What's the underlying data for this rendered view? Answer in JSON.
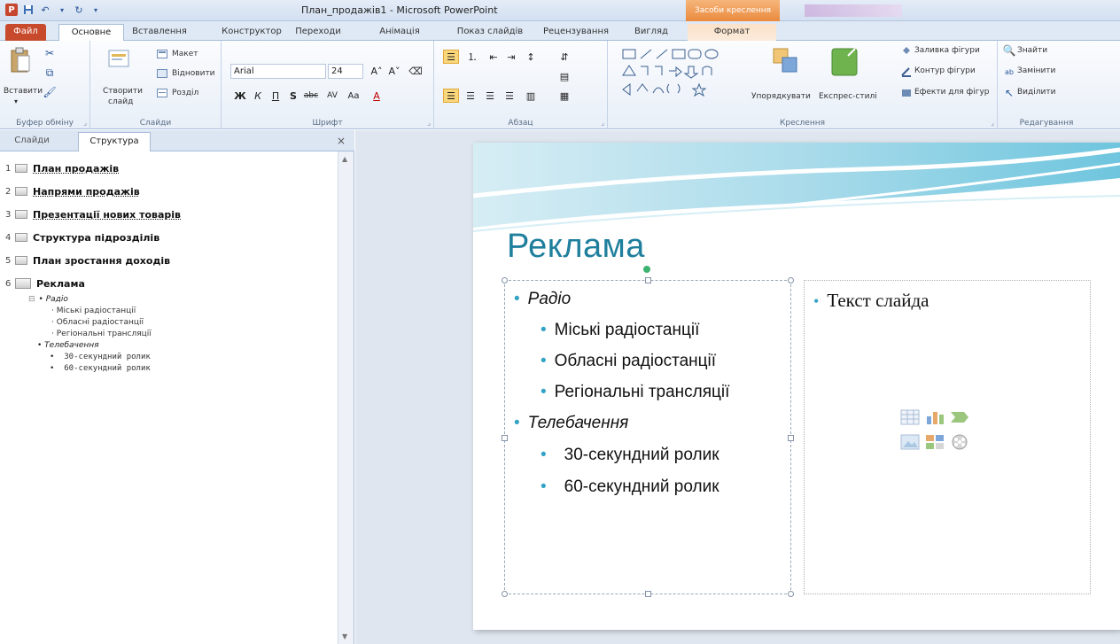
{
  "window": {
    "title": "План_продажів1 - Microsoft PowerPoint",
    "contextual_tab": "Засоби креслення"
  },
  "tabs": [
    "Файл",
    "Основне",
    "Вставлення",
    "Конструктор",
    "Переходи",
    "Анімація",
    "Показ слайдів",
    "Рецензування",
    "Вигляд",
    "Формат"
  ],
  "ribbon": {
    "clipboard": {
      "paste": "Вставити",
      "label": "Буфер обміну"
    },
    "slides": {
      "layout": "Макет",
      "reset": "Відновити",
      "new_slide_1": "Створити",
      "new_slide_2": "слайд",
      "section": "Розділ",
      "label": "Слайди"
    },
    "font": {
      "name": "Arial",
      "size": "24",
      "label": "Шрифт"
    },
    "paragraph": {
      "label": "Абзац"
    },
    "drawing": {
      "arrange": "Упорядкувати",
      "quick_styles": "Експрес-стилі",
      "fill": "Заливка фігури",
      "outline": "Контур фігури",
      "effects": "Ефекти для фігур",
      "label": "Креслення"
    },
    "editing": {
      "find": "Знайти",
      "replace": "Замінити",
      "select": "Виділити",
      "label": "Редагування"
    }
  },
  "panel": {
    "tab_slides": "Слайди",
    "tab_outline": "Структура",
    "close": "×",
    "outline": [
      {
        "num": "1",
        "title": "План продажів"
      },
      {
        "num": "2",
        "title": "Напрями продажів"
      },
      {
        "num": "3",
        "title": "Презентації нових товарів"
      },
      {
        "num": "4",
        "title": "Структура підрозділів"
      },
      {
        "num": "5",
        "title": "План зростання доходів"
      },
      {
        "num": "6",
        "title": "Реклама"
      }
    ],
    "sub": {
      "radio": "Радіо",
      "r1": "Міські радіостанції",
      "r2": "Обласні радіостанції",
      "r3": "Регіональні трансляції",
      "tv": "Телебачення",
      "t1": "30-секундний ролик",
      "t2": "60-секундний ролик"
    }
  },
  "slide": {
    "title": "Реклама",
    "left": {
      "radio": "Радіо",
      "r1": "Міські радіостанції",
      "r2": "Обласні радіостанції",
      "r3": "Регіональні трансляції",
      "tv": "Телебачення",
      "t1": "30-секундний ролик",
      "t2": "60-секундний ролик"
    },
    "right_placeholder": "Текст слайда"
  },
  "colors": {
    "accent": "#1f7f9d",
    "bullet": "#33a3c5",
    "file_tab": "#c74a2c",
    "contextual": "#ea8a3e"
  }
}
